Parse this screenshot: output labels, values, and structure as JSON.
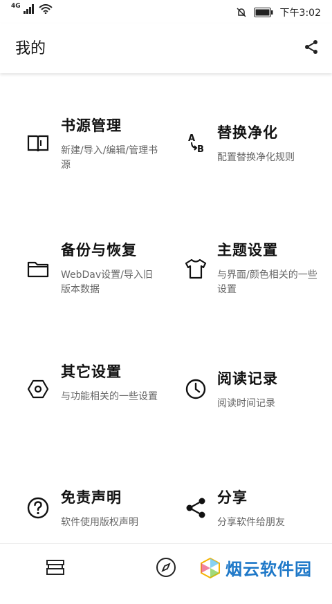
{
  "status": {
    "network": "4G",
    "time": "下午3:02"
  },
  "header": {
    "title": "我的"
  },
  "items": [
    {
      "title": "书源管理",
      "desc": "新建/导入/编辑/管理书源",
      "icon": "book-open-icon"
    },
    {
      "title": "替换净化",
      "desc": "配置替换净化规则",
      "icon": "replace-ab-icon"
    },
    {
      "title": "备份与恢复",
      "desc": "WebDav设置/导入旧版本数据",
      "icon": "folder-icon"
    },
    {
      "title": "主题设置",
      "desc": "与界面/颜色相关的一些设置",
      "icon": "tshirt-icon"
    },
    {
      "title": "其它设置",
      "desc": "与功能相关的一些设置",
      "icon": "hex-settings-icon"
    },
    {
      "title": "阅读记录",
      "desc": "阅读时间记录",
      "icon": "clock-icon"
    },
    {
      "title": "免责声明",
      "desc": "软件使用版权声明",
      "icon": "help-circle-icon"
    },
    {
      "title": "分享",
      "desc": "分享软件给朋友",
      "icon": "share-icon"
    }
  ],
  "watermark": {
    "text": "烟云软件园"
  }
}
